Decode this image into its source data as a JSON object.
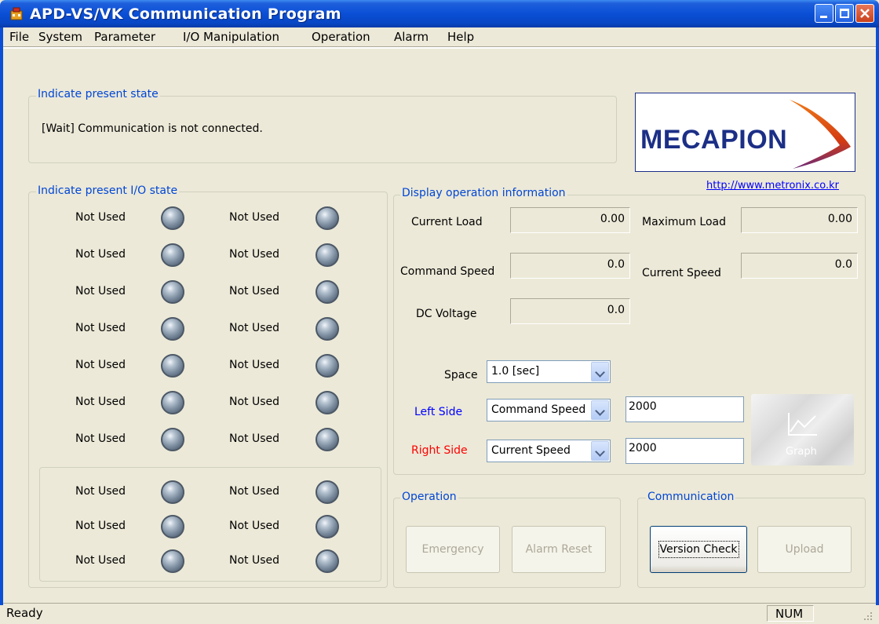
{
  "window": {
    "title": "APD-VS/VK Communication Program"
  },
  "menu": [
    "File",
    "System",
    "Parameter",
    "I/O Manipulation",
    "Operation",
    "Alarm",
    "Help"
  ],
  "present_state": {
    "label": "Indicate present state",
    "message": "[Wait] Communication is not connected."
  },
  "logo": {
    "text": "MECAPION",
    "link": "http://www.metronix.co.kr"
  },
  "io_state": {
    "label": "Indicate present I/O state",
    "left_items": [
      "Not Used",
      "Not Used",
      "Not Used",
      "Not Used",
      "Not Used",
      "Not Used",
      "Not Used",
      "Not Used",
      "Not Used",
      "Not Used"
    ],
    "right_items": [
      "Not Used",
      "Not Used",
      "Not Used",
      "Not Used",
      "Not Used",
      "Not Used",
      "Not Used",
      "Not Used",
      "Not Used",
      "Not Used"
    ]
  },
  "operation_info": {
    "label": "Display operation information",
    "current_load_label": "Current Load",
    "current_load": "0.00",
    "maximum_load_label": "Maximum Load",
    "maximum_load": "0.00",
    "command_speed_label": "Command Speed",
    "command_speed": "0.0",
    "current_speed_label": "Current Speed",
    "current_speed": "0.0",
    "dc_voltage_label": "DC Voltage",
    "dc_voltage": "0.0",
    "space_label": "Space",
    "space_value": "1.0 [sec]",
    "left_side_label": "Left Side",
    "left_side_value": "Command Speed",
    "left_side_scale": "2000",
    "right_side_label": "Right Side",
    "right_side_value": "Current Speed",
    "right_side_scale": "2000",
    "graph_label": "Graph"
  },
  "operation": {
    "label": "Operation",
    "emergency": "Emergency",
    "alarm_reset": "Alarm Reset"
  },
  "communication": {
    "label": "Communication",
    "version_check": "Version Check",
    "upload": "Upload"
  },
  "status": {
    "text": "Ready",
    "num": "NUM"
  },
  "colors": {
    "accent": "#0046d5",
    "left_side": "#0000ff",
    "right_side": "#ff0000"
  }
}
